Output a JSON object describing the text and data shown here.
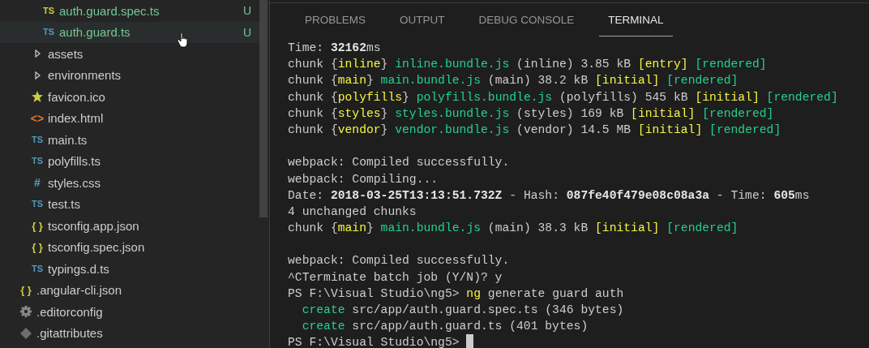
{
  "explorer": {
    "items": [
      {
        "children": [
          {
            "children": [
              {
                "label": "auth.guard.spec.ts",
                "kind": "spec",
                "icon": "TS",
                "status": "U",
                "hovered": false
              },
              {
                "label": "auth.guard.ts",
                "kind": "ts",
                "icon": "TS",
                "status": "U",
                "hovered": true
              }
            ]
          },
          {
            "label": "assets",
            "kind": "folder",
            "expanded": false,
            "hovered": false
          },
          {
            "label": "environments",
            "kind": "folder",
            "expanded": false,
            "hovered": false
          },
          {
            "label": "favicon.ico",
            "kind": "star",
            "hovered": false
          },
          {
            "label": "index.html",
            "kind": "html",
            "icon": "<>",
            "hovered": false
          },
          {
            "label": "main.ts",
            "kind": "ts",
            "icon": "TS",
            "hovered": false
          },
          {
            "label": "polyfills.ts",
            "kind": "ts",
            "icon": "TS",
            "hovered": false
          },
          {
            "label": "styles.css",
            "kind": "css",
            "icon": "#",
            "hovered": false
          },
          {
            "label": "test.ts",
            "kind": "ts",
            "icon": "TS",
            "hovered": false
          },
          {
            "label": "tsconfig.app.json",
            "kind": "json",
            "icon": "{ }",
            "hovered": false
          },
          {
            "label": "tsconfig.spec.json",
            "kind": "json",
            "icon": "{ }",
            "hovered": false
          },
          {
            "label": "typings.d.ts",
            "kind": "ts",
            "icon": "TS",
            "hovered": false
          }
        ]
      },
      {
        "label": ".angular-cli.json",
        "kind": "json",
        "icon": "{ }",
        "hovered": false
      },
      {
        "label": ".editorconfig",
        "kind": "gear",
        "hovered": false
      },
      {
        "label": ".gitattributes",
        "kind": "git",
        "hovered": false
      }
    ]
  },
  "panel": {
    "tabs": [
      {
        "label": "PROBLEMS",
        "selected": false
      },
      {
        "label": "OUTPUT",
        "selected": false
      },
      {
        "label": "DEBUG CONSOLE",
        "selected": false
      },
      {
        "label": "TERMINAL",
        "selected": true
      }
    ],
    "terminal": {
      "cursor": true,
      "lines": [
        {
          "kind": "output",
          "segments": [
            {
              "kind": "plain",
              "text": "Time: "
            },
            {
              "kind": "bold",
              "text": "32162"
            },
            {
              "kind": "plain",
              "text": "ms"
            }
          ]
        },
        {
          "kind": "output",
          "segments": [
            {
              "kind": "plain",
              "text": "chunk {"
            },
            {
              "kind": "yellow",
              "text": "inline"
            },
            {
              "kind": "plain",
              "text": "} "
            },
            {
              "kind": "green",
              "text": "inline.bundle.js"
            },
            {
              "kind": "plain",
              "text": " (inline) 3.85 kB "
            },
            {
              "kind": "yellow",
              "text": "[entry] "
            },
            {
              "kind": "green",
              "text": "[rendered]"
            }
          ]
        },
        {
          "kind": "output",
          "segments": [
            {
              "kind": "plain",
              "text": "chunk {"
            },
            {
              "kind": "yellow",
              "text": "main"
            },
            {
              "kind": "plain",
              "text": "} "
            },
            {
              "kind": "green",
              "text": "main.bundle.js"
            },
            {
              "kind": "plain",
              "text": " (main) 38.2 kB "
            },
            {
              "kind": "yellow",
              "text": "[initial] "
            },
            {
              "kind": "green",
              "text": "[rendered]"
            }
          ]
        },
        {
          "kind": "output",
          "segments": [
            {
              "kind": "plain",
              "text": "chunk {"
            },
            {
              "kind": "yellow",
              "text": "polyfills"
            },
            {
              "kind": "plain",
              "text": "} "
            },
            {
              "kind": "green",
              "text": "polyfills.bundle.js"
            },
            {
              "kind": "plain",
              "text": " (polyfills) 545 kB "
            },
            {
              "kind": "yellow",
              "text": "[initial] "
            },
            {
              "kind": "green",
              "text": "[rendered]"
            }
          ]
        },
        {
          "kind": "output",
          "segments": [
            {
              "kind": "plain",
              "text": "chunk {"
            },
            {
              "kind": "yellow",
              "text": "styles"
            },
            {
              "kind": "plain",
              "text": "} "
            },
            {
              "kind": "green",
              "text": "styles.bundle.js"
            },
            {
              "kind": "plain",
              "text": " (styles) 169 kB "
            },
            {
              "kind": "yellow",
              "text": "[initial] "
            },
            {
              "kind": "green",
              "text": "[rendered]"
            }
          ]
        },
        {
          "kind": "output",
          "segments": [
            {
              "kind": "plain",
              "text": "chunk {"
            },
            {
              "kind": "yellow",
              "text": "vendor"
            },
            {
              "kind": "plain",
              "text": "} "
            },
            {
              "kind": "green",
              "text": "vendor.bundle.js"
            },
            {
              "kind": "plain",
              "text": " (vendor) 14.5 MB "
            },
            {
              "kind": "yellow",
              "text": "[initial] "
            },
            {
              "kind": "green",
              "text": "[rendered]"
            }
          ]
        },
        {
          "kind": "blank"
        },
        {
          "kind": "output",
          "segments": [
            {
              "kind": "plain",
              "text": "webpack: Compiled successfully."
            }
          ]
        },
        {
          "kind": "output",
          "segments": [
            {
              "kind": "plain",
              "text": "webpack: Compiling..."
            }
          ]
        },
        {
          "kind": "output",
          "segments": [
            {
              "kind": "plain",
              "text": "Date: "
            },
            {
              "kind": "bold",
              "text": "2018-03-25T13:13:51.732Z"
            },
            {
              "kind": "plain",
              "text": " - Hash: "
            },
            {
              "kind": "bold",
              "text": "087fe40f479e08c08a3a"
            },
            {
              "kind": "plain",
              "text": " - Time: "
            },
            {
              "kind": "bold",
              "text": "605"
            },
            {
              "kind": "plain",
              "text": "ms"
            }
          ]
        },
        {
          "kind": "output",
          "segments": [
            {
              "kind": "plain",
              "text": "4 unchanged chunks"
            }
          ]
        },
        {
          "kind": "output",
          "segments": [
            {
              "kind": "plain",
              "text": "chunk {"
            },
            {
              "kind": "yellow",
              "text": "main"
            },
            {
              "kind": "plain",
              "text": "} "
            },
            {
              "kind": "green",
              "text": "main.bundle.js"
            },
            {
              "kind": "plain",
              "text": " (main) 38.3 kB "
            },
            {
              "kind": "yellow",
              "text": "[initial] "
            },
            {
              "kind": "green",
              "text": "[rendered]"
            }
          ]
        },
        {
          "kind": "blank"
        },
        {
          "kind": "output",
          "segments": [
            {
              "kind": "plain",
              "text": "webpack: Compiled successfully."
            }
          ]
        },
        {
          "kind": "output",
          "segments": [
            {
              "kind": "plain",
              "text": "^CTerminate batch job (Y/N)? y"
            }
          ]
        },
        {
          "kind": "output",
          "segments": [
            {
              "kind": "plain",
              "text": "PS F:\\Visual Studio\\ng5> "
            },
            {
              "kind": "yellow",
              "text": "ng"
            },
            {
              "kind": "plain",
              "text": " generate guard auth"
            }
          ]
        },
        {
          "kind": "output",
          "segments": [
            {
              "kind": "green",
              "text": "  create"
            },
            {
              "kind": "plain",
              "text": " src/app/auth.guard.spec.ts (346 bytes)"
            }
          ]
        },
        {
          "kind": "output",
          "segments": [
            {
              "kind": "green",
              "text": "  create"
            },
            {
              "kind": "plain",
              "text": " src/app/auth.guard.ts (401 bytes)"
            }
          ]
        },
        {
          "kind": "output",
          "segments": [
            {
              "kind": "plain",
              "text": "PS F:\\Visual Studio\\ng5> "
            }
          ]
        }
      ]
    }
  }
}
